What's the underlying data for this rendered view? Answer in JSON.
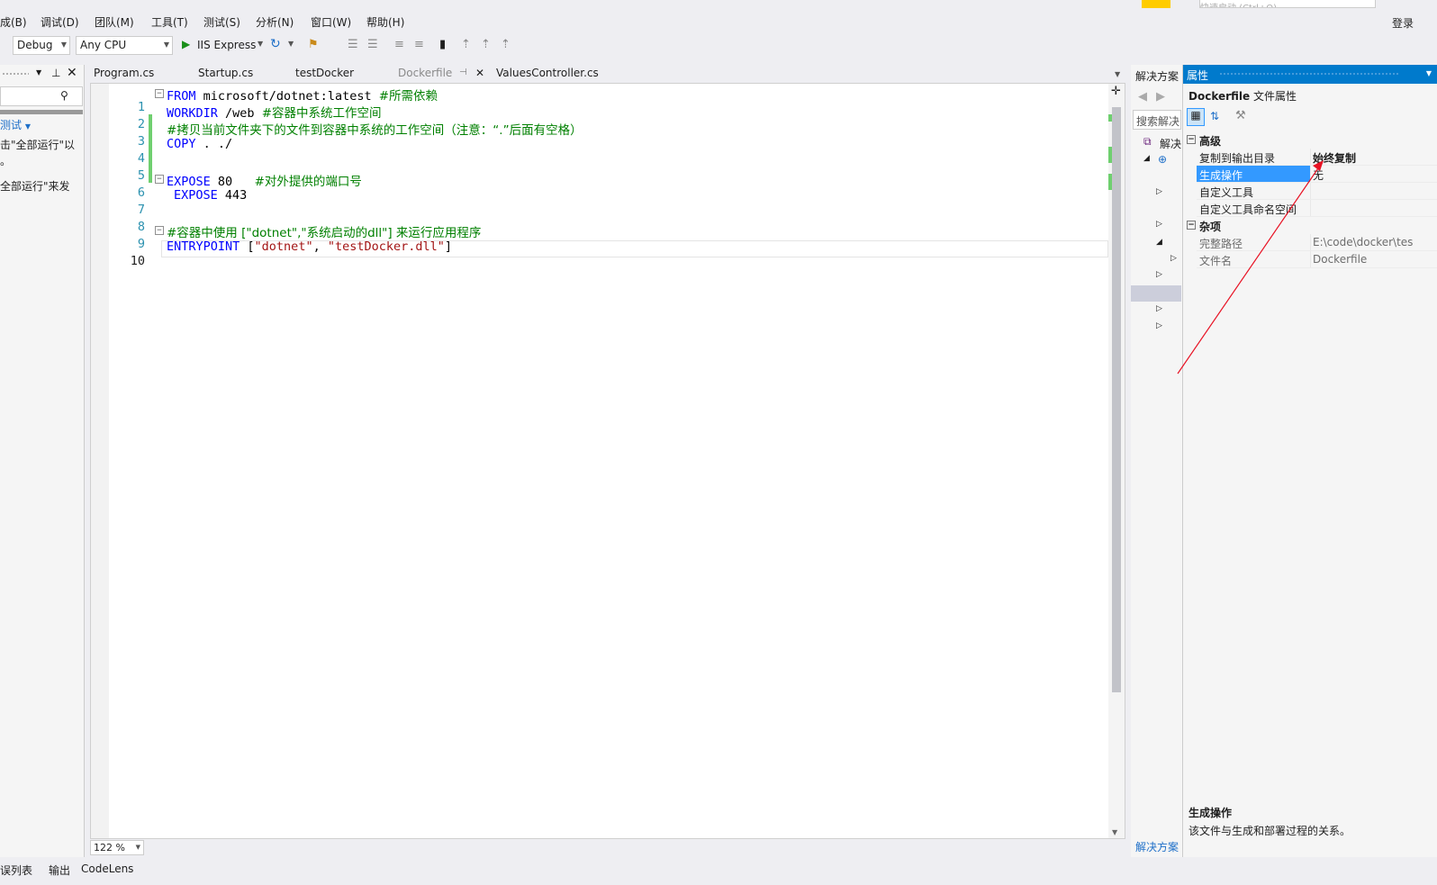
{
  "menu": [
    "成(B)",
    "调试(D)",
    "团队(M)",
    "工具(T)",
    "测试(S)",
    "分析(N)",
    "窗口(W)",
    "帮助(H)"
  ],
  "topbar": {
    "quick_launch": "快速启动 (Ctrl+Q)",
    "login": "登录"
  },
  "toolbar": {
    "config": "Debug",
    "platform": "Any CPU",
    "run_label": "IIS Express"
  },
  "left_panel": {
    "link": "测试",
    "line1": "击\"全部运行\"以",
    "line2": "。",
    "line3": "全部运行\"来发"
  },
  "tabs": [
    "Program.cs",
    "Startup.cs",
    "testDocker",
    "Dockerfile",
    "ValuesController.cs"
  ],
  "editor": {
    "zoom": "122 %",
    "lines": [
      {
        "n": "1",
        "kw": "FROM",
        "rest": " microsoft/dotnet:latest ",
        "comment": "#所需依赖"
      },
      {
        "n": "2",
        "kw": "WORKDIR",
        "rest": " /web ",
        "comment": "#容器中系统工作空间"
      },
      {
        "n": "3",
        "kw": "",
        "rest": "",
        "comment": "#拷贝当前文件夹下的文件到容器中系统的工作空间（注意：“.”后面有空格）"
      },
      {
        "n": "4",
        "kw": "COPY",
        "rest": " . ./",
        "comment": ""
      },
      {
        "n": "5",
        "kw": "",
        "rest": "",
        "comment": ""
      },
      {
        "n": "6",
        "kw": "EXPOSE",
        "rest": " 80   ",
        "comment": "#对外提供的端口号"
      },
      {
        "n": "7",
        "kw": "EXPOSE",
        "rest": " 443",
        "comment": ""
      },
      {
        "n": "8",
        "kw": "",
        "rest": "",
        "comment": ""
      },
      {
        "n": "9",
        "kw": "",
        "rest": "",
        "comment": "#容器中使用 [\"dotnet\",\"系统启动的dll\"] 来运行应用程序"
      },
      {
        "n": "10",
        "kw": "ENTRYPOINT",
        "rest": " [",
        "str1": "\"dotnet\"",
        "mid": ", ",
        "str2": "\"testDocker.dll\"",
        "end": "]"
      }
    ]
  },
  "solution": {
    "title": "解决方案",
    "search": "搜索解决",
    "node": "解决",
    "footer": "解决方案"
  },
  "properties": {
    "title": "属性",
    "object": "Dockerfile",
    "object_type": "文件属性",
    "cat_advanced": "高级",
    "copy_to_output": "复制到输出目录",
    "copy_to_output_val": "始终复制",
    "build_action": "生成操作",
    "build_action_val": "无",
    "custom_tool": "自定义工具",
    "custom_tool_ns": "自定义工具命名空间",
    "cat_misc": "杂项",
    "full_path": "完整路径",
    "full_path_val": "E:\\code\\docker\\tes",
    "file_name": "文件名",
    "file_name_val": "Dockerfile",
    "desc_title": "生成操作",
    "desc_text": "该文件与生成和部署过程的关系。"
  },
  "bottom_tabs": [
    "误列表",
    "输出",
    "CodeLens"
  ],
  "colors": {
    "accent": "#007acc",
    "selection": "#3399ff",
    "annotation_arrow": "#e81123"
  }
}
